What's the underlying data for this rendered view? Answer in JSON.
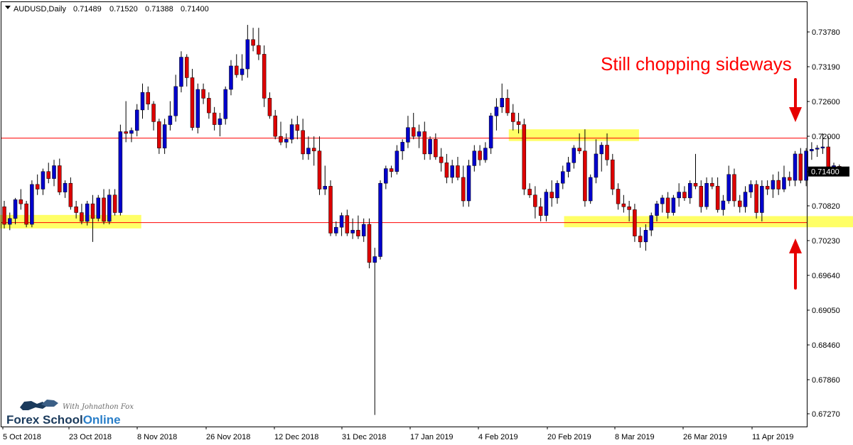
{
  "header": {
    "symbol": "AUDUSD,Daily",
    "open": "0.71489",
    "high": "0.71520",
    "low": "0.71388",
    "close": "0.71400"
  },
  "annotation": {
    "text": "Still chopping sideways"
  },
  "price_tag": "0.71400",
  "branding": {
    "tagline": "With Johnathon Fox",
    "name_part1": "Forex School",
    "name_part2": "Online"
  },
  "colors": {
    "bull_candle": "#0000cc",
    "bear_candle": "#dd0000",
    "level_line": "#ff0000",
    "zone_fill": "#ffff66",
    "annotation": "#ff0000",
    "brand_dark": "#1a3a5c",
    "brand_blue": "#2a7fc9"
  },
  "chart_data": {
    "type": "candlestick",
    "symbol": "AUDUSD",
    "timeframe": "Daily",
    "y_ticks": [
      "0.73780",
      "0.73190",
      "0.72600",
      "0.72000",
      "0.71400",
      "0.70820",
      "0.70230",
      "0.69640",
      "0.69050",
      "0.68460",
      "0.67860",
      "0.67270"
    ],
    "x_ticks": [
      "5 Oct 2018",
      "23 Oct 2018",
      "8 Nov 2018",
      "26 Nov 2018",
      "12 Dec 2018",
      "31 Dec 2018",
      "17 Jan 2019",
      "4 Feb 2019",
      "20 Feb 2019",
      "8 Mar 2019",
      "26 Mar 2019",
      "11 Apr 2019"
    ],
    "ylim": [
      0.671,
      0.741
    ],
    "horizontal_levels": [
      0.7197,
      0.7053
    ],
    "zones": [
      {
        "from_index": 0,
        "to_index": 24,
        "low": 0.7043,
        "high": 0.7066
      },
      {
        "from_index": 92,
        "to_index": 114,
        "low": 0.7192,
        "high": 0.7212
      },
      {
        "from_index": 102,
        "to_index": 154,
        "low": 0.7045,
        "high": 0.7064
      }
    ],
    "candles": [
      {
        "o": 0.708,
        "h": 0.709,
        "l": 0.7043,
        "c": 0.705
      },
      {
        "o": 0.705,
        "h": 0.707,
        "l": 0.704,
        "c": 0.706
      },
      {
        "o": 0.706,
        "h": 0.7095,
        "l": 0.705,
        "c": 0.7092
      },
      {
        "o": 0.7092,
        "h": 0.711,
        "l": 0.7075,
        "c": 0.7085
      },
      {
        "o": 0.7085,
        "h": 0.709,
        "l": 0.7045,
        "c": 0.705
      },
      {
        "o": 0.705,
        "h": 0.7125,
        "l": 0.7045,
        "c": 0.7118
      },
      {
        "o": 0.7118,
        "h": 0.7135,
        "l": 0.71,
        "c": 0.711
      },
      {
        "o": 0.711,
        "h": 0.7145,
        "l": 0.71,
        "c": 0.714
      },
      {
        "o": 0.714,
        "h": 0.7155,
        "l": 0.712,
        "c": 0.7128
      },
      {
        "o": 0.7128,
        "h": 0.716,
        "l": 0.7115,
        "c": 0.715
      },
      {
        "o": 0.715,
        "h": 0.7162,
        "l": 0.71,
        "c": 0.7105
      },
      {
        "o": 0.7105,
        "h": 0.7125,
        "l": 0.7095,
        "c": 0.712
      },
      {
        "o": 0.712,
        "h": 0.713,
        "l": 0.7075,
        "c": 0.708
      },
      {
        "o": 0.708,
        "h": 0.709,
        "l": 0.706,
        "c": 0.707
      },
      {
        "o": 0.707,
        "h": 0.7085,
        "l": 0.705,
        "c": 0.7055
      },
      {
        "o": 0.7055,
        "h": 0.709,
        "l": 0.7048,
        "c": 0.7085
      },
      {
        "o": 0.7085,
        "h": 0.71,
        "l": 0.702,
        "c": 0.706
      },
      {
        "o": 0.706,
        "h": 0.71,
        "l": 0.7055,
        "c": 0.7095
      },
      {
        "o": 0.7095,
        "h": 0.711,
        "l": 0.705,
        "c": 0.7055
      },
      {
        "o": 0.7055,
        "h": 0.711,
        "l": 0.705,
        "c": 0.71
      },
      {
        "o": 0.71,
        "h": 0.711,
        "l": 0.7065,
        "c": 0.707
      },
      {
        "o": 0.707,
        "h": 0.722,
        "l": 0.7065,
        "c": 0.7208
      },
      {
        "o": 0.7208,
        "h": 0.726,
        "l": 0.719,
        "c": 0.7205
      },
      {
        "o": 0.7205,
        "h": 0.7215,
        "l": 0.719,
        "c": 0.721
      },
      {
        "o": 0.721,
        "h": 0.7255,
        "l": 0.72,
        "c": 0.7245
      },
      {
        "o": 0.7245,
        "h": 0.729,
        "l": 0.723,
        "c": 0.7275
      },
      {
        "o": 0.7275,
        "h": 0.7285,
        "l": 0.7245,
        "c": 0.7255
      },
      {
        "o": 0.7255,
        "h": 0.726,
        "l": 0.721,
        "c": 0.7225
      },
      {
        "o": 0.7225,
        "h": 0.723,
        "l": 0.717,
        "c": 0.718
      },
      {
        "o": 0.718,
        "h": 0.723,
        "l": 0.717,
        "c": 0.722
      },
      {
        "o": 0.722,
        "h": 0.726,
        "l": 0.721,
        "c": 0.7235
      },
      {
        "o": 0.7235,
        "h": 0.7305,
        "l": 0.7225,
        "c": 0.7285
      },
      {
        "o": 0.7285,
        "h": 0.7345,
        "l": 0.7275,
        "c": 0.7335
      },
      {
        "o": 0.7335,
        "h": 0.734,
        "l": 0.7285,
        "c": 0.73
      },
      {
        "o": 0.73,
        "h": 0.7315,
        "l": 0.721,
        "c": 0.7215
      },
      {
        "o": 0.7215,
        "h": 0.729,
        "l": 0.7205,
        "c": 0.728
      },
      {
        "o": 0.728,
        "h": 0.729,
        "l": 0.7255,
        "c": 0.7265
      },
      {
        "o": 0.7265,
        "h": 0.7275,
        "l": 0.723,
        "c": 0.724
      },
      {
        "o": 0.724,
        "h": 0.725,
        "l": 0.721,
        "c": 0.722
      },
      {
        "o": 0.722,
        "h": 0.724,
        "l": 0.72,
        "c": 0.723
      },
      {
        "o": 0.723,
        "h": 0.7285,
        "l": 0.722,
        "c": 0.728
      },
      {
        "o": 0.728,
        "h": 0.733,
        "l": 0.727,
        "c": 0.732
      },
      {
        "o": 0.732,
        "h": 0.734,
        "l": 0.73,
        "c": 0.7305
      },
      {
        "o": 0.7305,
        "h": 0.734,
        "l": 0.7295,
        "c": 0.7315
      },
      {
        "o": 0.7315,
        "h": 0.739,
        "l": 0.73,
        "c": 0.7365
      },
      {
        "o": 0.7365,
        "h": 0.7385,
        "l": 0.7345,
        "c": 0.7355
      },
      {
        "o": 0.7355,
        "h": 0.7385,
        "l": 0.733,
        "c": 0.734
      },
      {
        "o": 0.734,
        "h": 0.7355,
        "l": 0.725,
        "c": 0.7265
      },
      {
        "o": 0.7265,
        "h": 0.7275,
        "l": 0.723,
        "c": 0.7235
      },
      {
        "o": 0.7235,
        "h": 0.7245,
        "l": 0.7195,
        "c": 0.72
      },
      {
        "o": 0.72,
        "h": 0.7225,
        "l": 0.7185,
        "c": 0.719
      },
      {
        "o": 0.719,
        "h": 0.7205,
        "l": 0.718,
        "c": 0.7195
      },
      {
        "o": 0.7195,
        "h": 0.723,
        "l": 0.7188,
        "c": 0.722
      },
      {
        "o": 0.722,
        "h": 0.7235,
        "l": 0.7195,
        "c": 0.721
      },
      {
        "o": 0.721,
        "h": 0.723,
        "l": 0.716,
        "c": 0.717
      },
      {
        "o": 0.717,
        "h": 0.72,
        "l": 0.716,
        "c": 0.718
      },
      {
        "o": 0.718,
        "h": 0.72,
        "l": 0.715,
        "c": 0.7175
      },
      {
        "o": 0.7175,
        "h": 0.72,
        "l": 0.71,
        "c": 0.711
      },
      {
        "o": 0.711,
        "h": 0.715,
        "l": 0.71,
        "c": 0.7115
      },
      {
        "o": 0.7115,
        "h": 0.7125,
        "l": 0.703,
        "c": 0.7035
      },
      {
        "o": 0.7035,
        "h": 0.7055,
        "l": 0.703,
        "c": 0.7045
      },
      {
        "o": 0.7045,
        "h": 0.707,
        "l": 0.703,
        "c": 0.7065
      },
      {
        "o": 0.7065,
        "h": 0.7075,
        "l": 0.703,
        "c": 0.7035
      },
      {
        "o": 0.7035,
        "h": 0.706,
        "l": 0.7025,
        "c": 0.704
      },
      {
        "o": 0.704,
        "h": 0.7065,
        "l": 0.7025,
        "c": 0.703
      },
      {
        "o": 0.703,
        "h": 0.706,
        "l": 0.702,
        "c": 0.705
      },
      {
        "o": 0.705,
        "h": 0.706,
        "l": 0.6975,
        "c": 0.6985
      },
      {
        "o": 0.6985,
        "h": 0.701,
        "l": 0.6725,
        "c": 0.6995
      },
      {
        "o": 0.6995,
        "h": 0.7125,
        "l": 0.699,
        "c": 0.712
      },
      {
        "o": 0.712,
        "h": 0.715,
        "l": 0.711,
        "c": 0.7145
      },
      {
        "o": 0.7145,
        "h": 0.715,
        "l": 0.713,
        "c": 0.714
      },
      {
        "o": 0.714,
        "h": 0.7185,
        "l": 0.7135,
        "c": 0.7175
      },
      {
        "o": 0.7175,
        "h": 0.7195,
        "l": 0.716,
        "c": 0.719
      },
      {
        "o": 0.719,
        "h": 0.7235,
        "l": 0.718,
        "c": 0.7215
      },
      {
        "o": 0.7215,
        "h": 0.724,
        "l": 0.7195,
        "c": 0.72
      },
      {
        "o": 0.72,
        "h": 0.722,
        "l": 0.718,
        "c": 0.7208
      },
      {
        "o": 0.7208,
        "h": 0.7225,
        "l": 0.716,
        "c": 0.717
      },
      {
        "o": 0.717,
        "h": 0.72,
        "l": 0.716,
        "c": 0.7195
      },
      {
        "o": 0.7195,
        "h": 0.7205,
        "l": 0.716,
        "c": 0.7165
      },
      {
        "o": 0.7165,
        "h": 0.718,
        "l": 0.714,
        "c": 0.7155
      },
      {
        "o": 0.7155,
        "h": 0.717,
        "l": 0.712,
        "c": 0.713
      },
      {
        "o": 0.713,
        "h": 0.716,
        "l": 0.712,
        "c": 0.715
      },
      {
        "o": 0.715,
        "h": 0.7165,
        "l": 0.7125,
        "c": 0.713
      },
      {
        "o": 0.713,
        "h": 0.715,
        "l": 0.708,
        "c": 0.709
      },
      {
        "o": 0.709,
        "h": 0.716,
        "l": 0.708,
        "c": 0.715
      },
      {
        "o": 0.715,
        "h": 0.7185,
        "l": 0.714,
        "c": 0.7175
      },
      {
        "o": 0.7175,
        "h": 0.7185,
        "l": 0.715,
        "c": 0.716
      },
      {
        "o": 0.716,
        "h": 0.719,
        "l": 0.7155,
        "c": 0.718
      },
      {
        "o": 0.718,
        "h": 0.724,
        "l": 0.717,
        "c": 0.7235
      },
      {
        "o": 0.7235,
        "h": 0.7265,
        "l": 0.721,
        "c": 0.725
      },
      {
        "o": 0.725,
        "h": 0.729,
        "l": 0.724,
        "c": 0.7265
      },
      {
        "o": 0.7265,
        "h": 0.728,
        "l": 0.7235,
        "c": 0.724
      },
      {
        "o": 0.724,
        "h": 0.7255,
        "l": 0.721,
        "c": 0.7225
      },
      {
        "o": 0.7225,
        "h": 0.724,
        "l": 0.7205,
        "c": 0.722
      },
      {
        "o": 0.722,
        "h": 0.723,
        "l": 0.71,
        "c": 0.711
      },
      {
        "o": 0.711,
        "h": 0.712,
        "l": 0.7095,
        "c": 0.71
      },
      {
        "o": 0.71,
        "h": 0.7115,
        "l": 0.706,
        "c": 0.708
      },
      {
        "o": 0.708,
        "h": 0.7095,
        "l": 0.7055,
        "c": 0.7065
      },
      {
        "o": 0.7065,
        "h": 0.711,
        "l": 0.7055,
        "c": 0.7105
      },
      {
        "o": 0.7105,
        "h": 0.7125,
        "l": 0.708,
        "c": 0.7095
      },
      {
        "o": 0.7095,
        "h": 0.7125,
        "l": 0.7085,
        "c": 0.712
      },
      {
        "o": 0.712,
        "h": 0.715,
        "l": 0.711,
        "c": 0.714
      },
      {
        "o": 0.714,
        "h": 0.7165,
        "l": 0.713,
        "c": 0.7155
      },
      {
        "o": 0.7155,
        "h": 0.7185,
        "l": 0.7145,
        "c": 0.718
      },
      {
        "o": 0.718,
        "h": 0.7205,
        "l": 0.717,
        "c": 0.7175
      },
      {
        "o": 0.7175,
        "h": 0.7212,
        "l": 0.708,
        "c": 0.709
      },
      {
        "o": 0.709,
        "h": 0.7135,
        "l": 0.7085,
        "c": 0.713
      },
      {
        "o": 0.713,
        "h": 0.7195,
        "l": 0.712,
        "c": 0.717
      },
      {
        "o": 0.717,
        "h": 0.719,
        "l": 0.714,
        "c": 0.7185
      },
      {
        "o": 0.7185,
        "h": 0.7205,
        "l": 0.715,
        "c": 0.716
      },
      {
        "o": 0.716,
        "h": 0.717,
        "l": 0.71,
        "c": 0.711
      },
      {
        "o": 0.711,
        "h": 0.712,
        "l": 0.7075,
        "c": 0.7085
      },
      {
        "o": 0.7085,
        "h": 0.71,
        "l": 0.707,
        "c": 0.708
      },
      {
        "o": 0.708,
        "h": 0.709,
        "l": 0.7055,
        "c": 0.7075
      },
      {
        "o": 0.7075,
        "h": 0.7085,
        "l": 0.702,
        "c": 0.703
      },
      {
        "o": 0.703,
        "h": 0.7045,
        "l": 0.701,
        "c": 0.702
      },
      {
        "o": 0.702,
        "h": 0.705,
        "l": 0.7005,
        "c": 0.704
      },
      {
        "o": 0.704,
        "h": 0.707,
        "l": 0.703,
        "c": 0.7065
      },
      {
        "o": 0.7065,
        "h": 0.709,
        "l": 0.7055,
        "c": 0.7085
      },
      {
        "o": 0.7085,
        "h": 0.71,
        "l": 0.707,
        "c": 0.7095
      },
      {
        "o": 0.7095,
        "h": 0.7105,
        "l": 0.706,
        "c": 0.707
      },
      {
        "o": 0.707,
        "h": 0.71,
        "l": 0.7065,
        "c": 0.7095
      },
      {
        "o": 0.7095,
        "h": 0.712,
        "l": 0.708,
        "c": 0.7105
      },
      {
        "o": 0.7105,
        "h": 0.7115,
        "l": 0.709,
        "c": 0.7095
      },
      {
        "o": 0.7095,
        "h": 0.7125,
        "l": 0.7085,
        "c": 0.712
      },
      {
        "o": 0.712,
        "h": 0.717,
        "l": 0.711,
        "c": 0.7115
      },
      {
        "o": 0.7115,
        "h": 0.7125,
        "l": 0.707,
        "c": 0.708
      },
      {
        "o": 0.708,
        "h": 0.713,
        "l": 0.7075,
        "c": 0.712
      },
      {
        "o": 0.712,
        "h": 0.713,
        "l": 0.711,
        "c": 0.7115
      },
      {
        "o": 0.7115,
        "h": 0.713,
        "l": 0.707,
        "c": 0.7075
      },
      {
        "o": 0.7075,
        "h": 0.71,
        "l": 0.7065,
        "c": 0.709
      },
      {
        "o": 0.709,
        "h": 0.715,
        "l": 0.7085,
        "c": 0.7135
      },
      {
        "o": 0.7135,
        "h": 0.7145,
        "l": 0.708,
        "c": 0.709
      },
      {
        "o": 0.709,
        "h": 0.71,
        "l": 0.707,
        "c": 0.708
      },
      {
        "o": 0.708,
        "h": 0.7115,
        "l": 0.707,
        "c": 0.7105
      },
      {
        "o": 0.7105,
        "h": 0.7125,
        "l": 0.7095,
        "c": 0.7118
      },
      {
        "o": 0.7118,
        "h": 0.7125,
        "l": 0.706,
        "c": 0.707
      },
      {
        "o": 0.707,
        "h": 0.7125,
        "l": 0.7055,
        "c": 0.7115
      },
      {
        "o": 0.7115,
        "h": 0.7125,
        "l": 0.71,
        "c": 0.711
      },
      {
        "o": 0.711,
        "h": 0.7135,
        "l": 0.7095,
        "c": 0.7125
      },
      {
        "o": 0.7125,
        "h": 0.714,
        "l": 0.71,
        "c": 0.711
      },
      {
        "o": 0.711,
        "h": 0.715,
        "l": 0.7105,
        "c": 0.713
      },
      {
        "o": 0.713,
        "h": 0.714,
        "l": 0.7115,
        "c": 0.7125
      },
      {
        "o": 0.7125,
        "h": 0.7175,
        "l": 0.7115,
        "c": 0.717
      },
      {
        "o": 0.717,
        "h": 0.718,
        "l": 0.712,
        "c": 0.7125
      },
      {
        "o": 0.7125,
        "h": 0.718,
        "l": 0.7115,
        "c": 0.7175
      },
      {
        "o": 0.7175,
        "h": 0.719,
        "l": 0.716,
        "c": 0.7178
      },
      {
        "o": 0.7178,
        "h": 0.7185,
        "l": 0.7165,
        "c": 0.718
      },
      {
        "o": 0.718,
        "h": 0.7205,
        "l": 0.717,
        "c": 0.7182
      },
      {
        "o": 0.7182,
        "h": 0.72,
        "l": 0.714,
        "c": 0.7145
      },
      {
        "o": 0.7145,
        "h": 0.7155,
        "l": 0.714,
        "c": 0.715
      },
      {
        "o": 0.71489,
        "h": 0.7152,
        "l": 0.71388,
        "c": 0.714
      }
    ]
  }
}
